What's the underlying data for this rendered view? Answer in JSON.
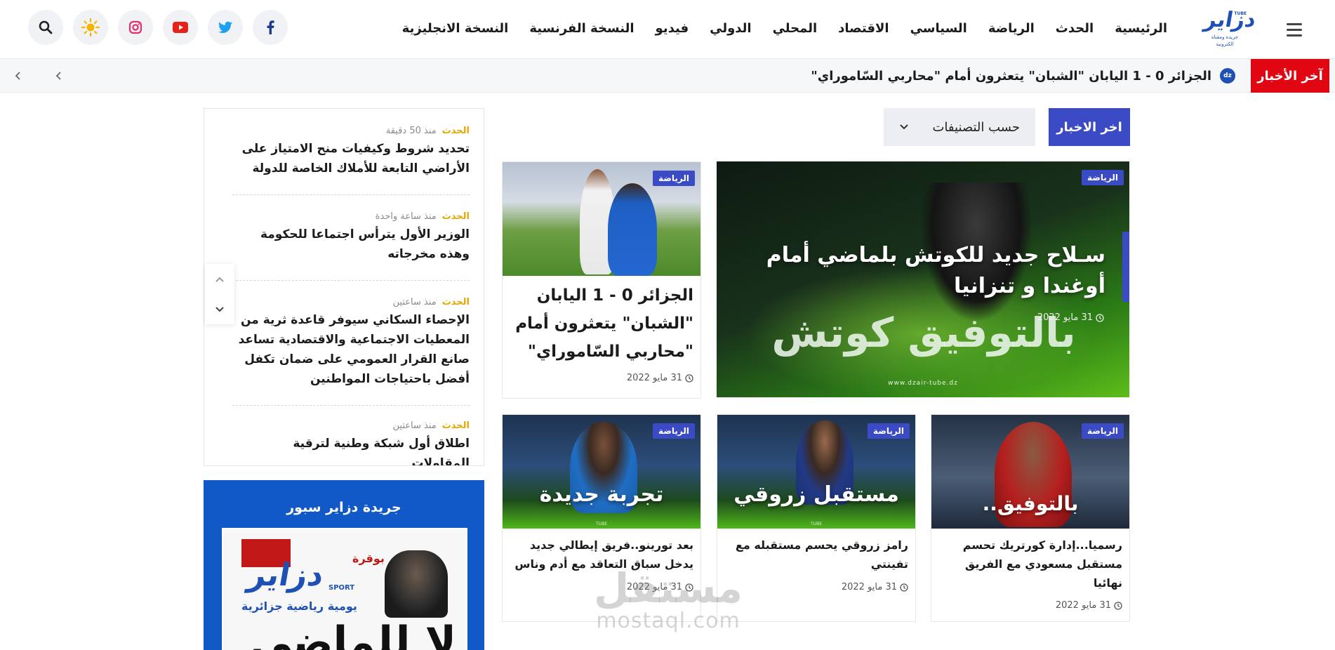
{
  "brand": {
    "logo_text": "دزاير",
    "logo_sub": "جريدة ومقناة الكترونية",
    "logo_tag": "TUBE",
    "accent": "#3a4bc5",
    "logo_color": "#1f50b5"
  },
  "nav": {
    "items": [
      "الرئيسية",
      "الحدث",
      "الرياضة",
      "السياسي",
      "الاقتصاد",
      "المحلي",
      "الدولي",
      "فيديو",
      "النسخة الفرنسية",
      "النسخة الانجليزية"
    ]
  },
  "header_icons": [
    "facebook-icon",
    "twitter-icon",
    "youtube-icon",
    "instagram-icon",
    "sun-icon",
    "search-icon"
  ],
  "ticker": {
    "label": "آخر الأخبار",
    "text": "الجزائر 0 - 1 اليابان \"الشبان\" يتعثرون أمام \"محاربي السّاموراي\"",
    "label_color": "#e00612"
  },
  "main": {
    "latest_button": "اخر الاخبار",
    "categories_button": "حسب التصنيفات",
    "featured": {
      "tag": "الرياضة",
      "title": "سـلاح جديد للكوتش بلماضي أمام أوغندا و تنزانيا",
      "date": "31 مايو 2022",
      "image_text": "بالتوفيق كوتش",
      "image_footer": "www.dzair-tube.dz"
    },
    "side_card": {
      "tag": "الرياضة",
      "title": "الجزائر 0 - 1 اليابان \"الشبان\" يتعثرون أمام \"محاربي السّاموراي\"",
      "date": "31 مايو 2022"
    },
    "cards": [
      {
        "tag": "الرياضة",
        "title": "رسميا...إدارة كورتريك تحسم مستقبل مسعودي مع الفريق نهائيا",
        "date": "31 مايو 2022",
        "image_text": "بالتوفيق.."
      },
      {
        "tag": "الرياضة",
        "title": "رامز زروقي يحسم مستقبله مع تفينتي",
        "date": "31 مايو 2022",
        "image_text": "مستقبل زروقي"
      },
      {
        "tag": "الرياضة",
        "title": "بعد تورينو..فريق إيطالي جديد يدخل سباق التعاقد مع أدم وناس",
        "date": "31 مايو 2022",
        "image_text": "تجربة جديدة"
      }
    ]
  },
  "sidebar": {
    "items": [
      {
        "category": "الحدث",
        "time": "منذ 50 دقيقة",
        "title": "تحديد شروط وكيفيات منح الامتياز على الأراضي التابعة للأملاك الخاصة للدولة"
      },
      {
        "category": "الحدث",
        "time": "منذ ساعة واحدة",
        "title": "الوزير الأول يترأس اجتماعا للحكومة وهذه مخرجاته"
      },
      {
        "category": "الحدث",
        "time": "منذ ساعتين",
        "title": "الإحصاء السكاني سيوفر قاعدة ثرية من المعطيات الاجتماعية والاقتصادية تساعد صانع القرار العمومي على ضمان تكفل أفضل باحتياجات المواطنين"
      },
      {
        "category": "الحدث",
        "time": "منذ ساعتين",
        "title": "اطلاق أول شبكة وطنية لترقية المقاولات"
      }
    ],
    "newspaper_title": "جريدة دزاير سبور",
    "newspaper": {
      "logo": "دزاير",
      "sport": "SPORT",
      "daily": "يومية رياضية جزائرية",
      "headline": "لا للماضي",
      "highlight": "بوقرة"
    }
  },
  "watermark": {
    "arabic": "مستقل",
    "latin": "mostaql.com"
  }
}
